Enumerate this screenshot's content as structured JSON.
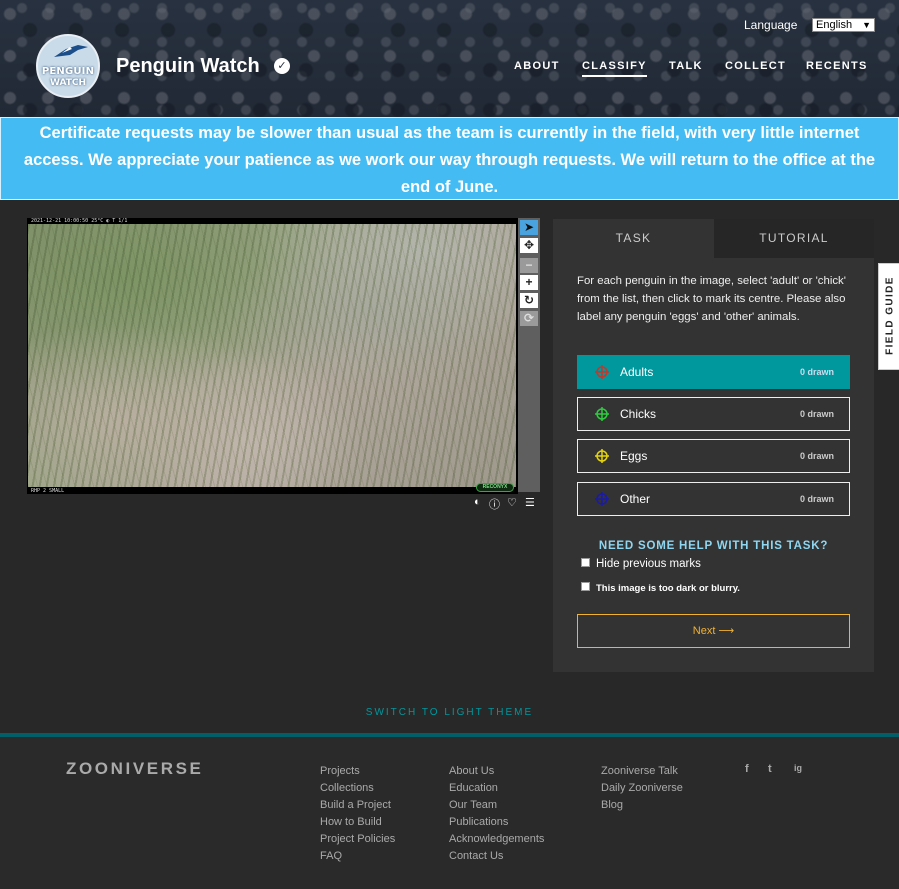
{
  "header": {
    "logo_line1": "PENGUIN",
    "logo_line2": "WATCH",
    "project_title": "Penguin Watch",
    "language_label": "Language",
    "language_value": "English",
    "nav": [
      "ABOUT",
      "CLASSIFY",
      "TALK",
      "COLLECT",
      "RECENTS"
    ],
    "active_nav": "CLASSIFY"
  },
  "announcement": "Certificate requests may be slower than usual as the team is currently in the field, with very little internet access. We appreciate your patience as we work our way through requests. We will return to the office at the end of June.",
  "subject": {
    "meta_top": "2021-12-21 10:00:50     25°C  ◐      T 1/1",
    "meta_bottom": "RHP 2 SMALL",
    "camera_brand": "RECONYX"
  },
  "tools": {
    "pointer": "pointer-icon",
    "pan": "pan-icon",
    "zoom_out": "zoom-out-icon",
    "zoom_in": "zoom-in-icon",
    "rotate": "rotate-icon",
    "reset": "reset-icon"
  },
  "task_panel": {
    "tab_task": "TASK",
    "tab_tutorial": "TUTORIAL",
    "instructions": "For each penguin in the image, select 'adult' or 'chick' from the list, then click to mark its centre. Please also label any penguin 'eggs' and 'other' animals.",
    "options": [
      {
        "label": "Adults",
        "count": "0 drawn",
        "color": "#c0392b"
      },
      {
        "label": "Chicks",
        "count": "0 drawn",
        "color": "#2ecc40"
      },
      {
        "label": "Eggs",
        "count": "0 drawn",
        "color": "#e5d40a"
      },
      {
        "label": "Other",
        "count": "0 drawn",
        "color": "#1a1aa6"
      }
    ],
    "help_link": "NEED SOME HELP WITH THIS TASK?",
    "hide_marks": "Hide previous marks",
    "too_dark": "This image is too dark or blurry.",
    "next_label": "Next ⟶"
  },
  "field_guide": "FIELD GUIDE",
  "switch_theme": "SWITCH TO LIGHT THEME",
  "footer": {
    "logo": "ZOONIVERSE",
    "col1": [
      "Projects",
      "Collections",
      "Build a Project",
      "How to Build",
      "Project Policies",
      "FAQ"
    ],
    "col2": [
      "About Us",
      "Education",
      "Our Team",
      "Publications",
      "Acknowledgements",
      "Contact Us"
    ],
    "col3": [
      "Zooniverse Talk",
      "Daily Zooniverse",
      "Blog"
    ],
    "social": [
      "f",
      "t",
      "ig"
    ]
  },
  "colors": {
    "announcement_bg": "#44bbf2",
    "accent_teal": "#00979d",
    "next_button": "#f2b12f"
  }
}
